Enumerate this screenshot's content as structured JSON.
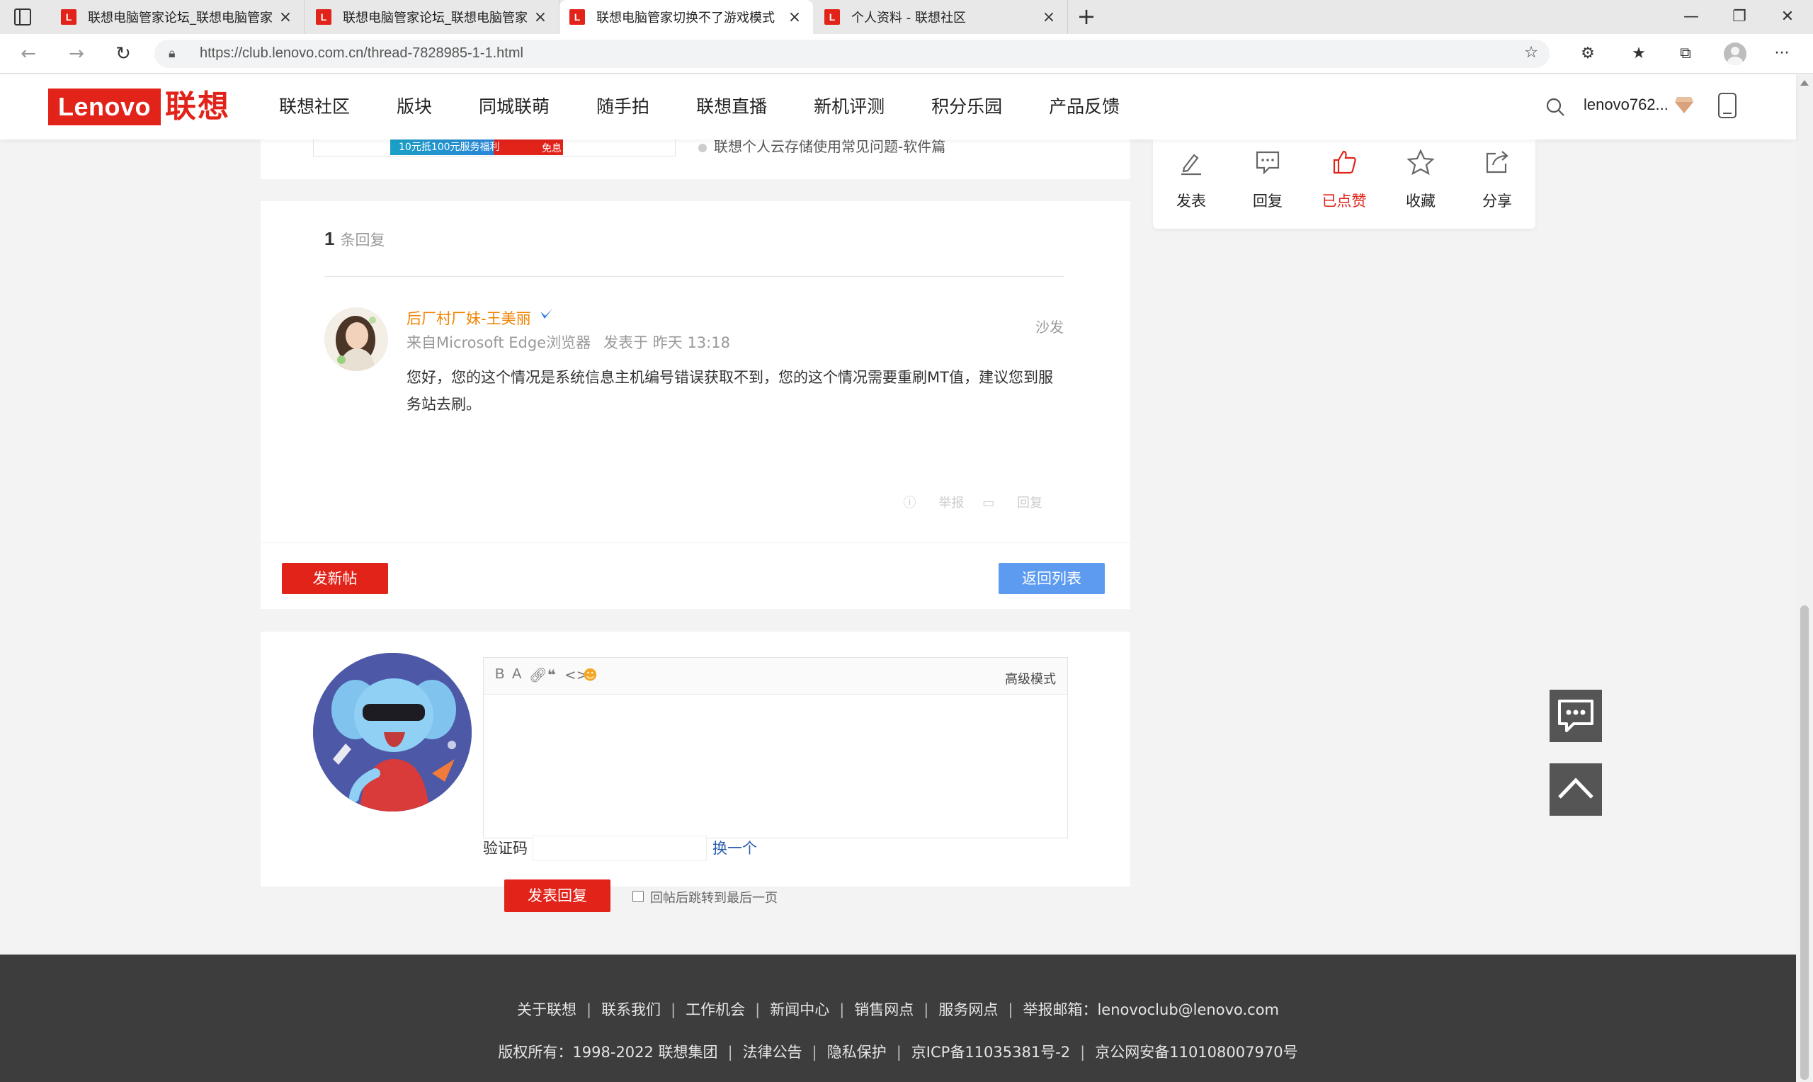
{
  "browser": {
    "tabs": [
      {
        "title": "联想电脑管家论坛_联想电脑管家",
        "active": false
      },
      {
        "title": "联想电脑管家论坛_联想电脑管家",
        "active": false
      },
      {
        "title": "联想电脑管家切换不了游戏模式",
        "active": true
      },
      {
        "title": "个人资料 - 联想社区",
        "active": false
      }
    ],
    "favicon_letter": "L",
    "url": "https://club.lenovo.com.cn/thread-7828985-1-1.html"
  },
  "header": {
    "logo_en": "Lenovo",
    "logo_cn": "联想",
    "nav": [
      "联想社区",
      "版块",
      "同城联萌",
      "随手拍",
      "联想直播",
      "新机评测",
      "积分乐园",
      "产品反馈"
    ],
    "username": "lenovo762..."
  },
  "top_card": {
    "ad_text": "10元抵100元服务福利",
    "ad_tag": "免息",
    "related_link": "联想个人云存储使用常见问题-软件篇"
  },
  "actions": {
    "post": "发表",
    "reply": "回复",
    "liked": "已点赞",
    "favorite": "收藏",
    "share": "分享",
    "accent": "#e2231a"
  },
  "replies": {
    "count": "1",
    "count_label": "条回复",
    "items": [
      {
        "author": "后厂村厂妹-王美丽",
        "source": "来自Microsoft Edge浏览器",
        "time": "发表于 昨天 13:18",
        "floor": "沙发",
        "content": "您好，您的这个情况是系统信息主机编号错误获取不到，您的这个情况需要重刷MT值，建议您到服务站去刷。",
        "report": "举报",
        "reply": "回复"
      }
    ]
  },
  "buttons": {
    "new_post": "发新帖",
    "back_list": "返回列表"
  },
  "compose": {
    "toolbar": [
      "B",
      "A"
    ],
    "advanced": "高级模式",
    "captcha_label": "验证码",
    "captcha_refresh": "换一个",
    "submit": "发表回复",
    "jump_label": "回帖后跳转到最后一页"
  },
  "footer": {
    "links": [
      "关于联想",
      "联系我们",
      "工作机会",
      "新闻中心",
      "销售网点",
      "服务网点",
      "举报邮箱：lenovoclub@lenovo.com"
    ],
    "copyright": [
      "版权所有：1998-2022 联想集团",
      "法律公告",
      "隐私保护",
      "京ICP备11035381号-2",
      "京公网安备110108007970号"
    ]
  }
}
